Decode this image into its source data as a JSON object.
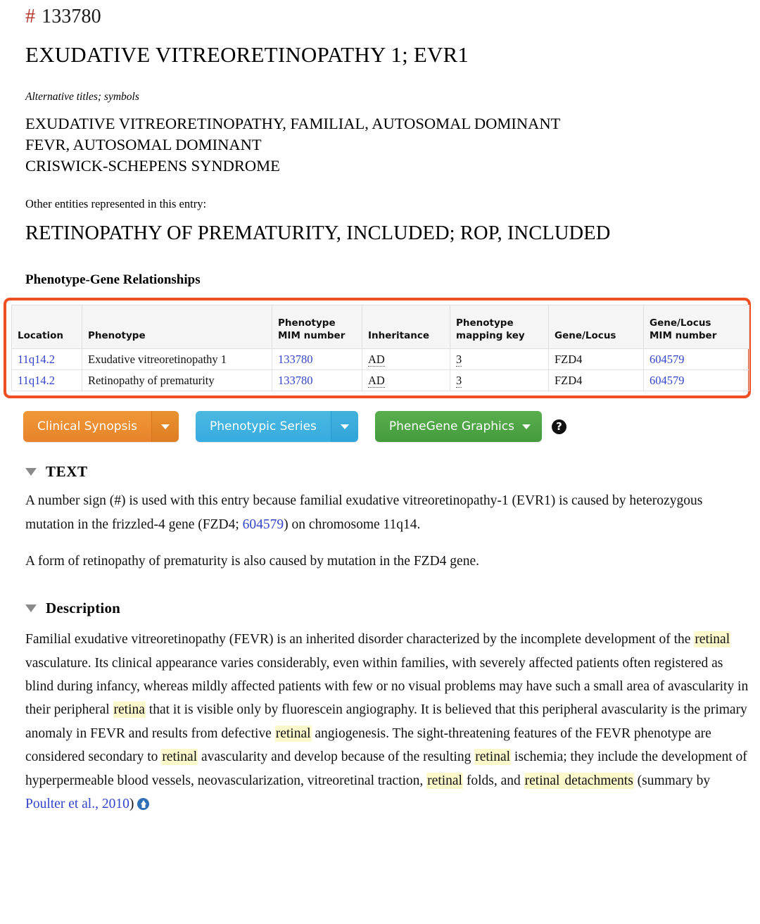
{
  "entry": {
    "hash_symbol": "#",
    "mim_number": "133780",
    "title": "EXUDATIVE VITREORETINOPATHY 1; EVR1",
    "alt_titles_label": "Alternative titles; symbols",
    "alt_titles": [
      "EXUDATIVE VITREORETINOPATHY, FAMILIAL, AUTOSOMAL DOMINANT",
      "FEVR, AUTOSOMAL DOMINANT",
      "CRISWICK-SCHEPENS SYNDROME"
    ],
    "other_entities_label": "Other entities represented in this entry:",
    "included_title": "RETINOPATHY OF PREMATURITY, INCLUDED; ROP, INCLUDED"
  },
  "pgr": {
    "heading": "Phenotype-Gene Relationships",
    "highlight_color": "#f04e23",
    "columns": [
      "Location",
      "Phenotype",
      "Phenotype MIM number",
      "Inheritance",
      "Phenotype mapping key",
      "Gene/Locus",
      "Gene/Locus MIM number"
    ],
    "columns_split": [
      [
        "Location",
        ""
      ],
      [
        "Phenotype",
        ""
      ],
      [
        "Phenotype",
        "MIM number"
      ],
      [
        "Inheritance",
        ""
      ],
      [
        "Phenotype",
        "mapping key"
      ],
      [
        "Gene/Locus",
        ""
      ],
      [
        "Gene/Locus",
        "MIM number"
      ]
    ],
    "rows": [
      {
        "location": "11q14.2",
        "phenotype": "Exudative vitreoretinopathy 1",
        "phenotype_mim": "133780",
        "inheritance": "AD",
        "mapping_key": "3",
        "gene_locus": "FZD4",
        "gene_mim": "604579"
      },
      {
        "location": "11q14.2",
        "phenotype": "Retinopathy of prematurity",
        "phenotype_mim": "133780",
        "inheritance": "AD",
        "mapping_key": "3",
        "gene_locus": "FZD4",
        "gene_mim": "604579"
      }
    ]
  },
  "buttons": {
    "clinical_synopsis": {
      "label": "Clinical Synopsis",
      "color": "#e8832a"
    },
    "phenotypic_series": {
      "label": "Phenotypic Series",
      "color": "#36ace0"
    },
    "phenegene_graphics": {
      "label": "PheneGene Graphics",
      "color": "#449b3c"
    },
    "help_glyph": "?"
  },
  "text_section": {
    "title": "TEXT",
    "paragraph1_part1": "A number sign (#) is used with this entry because familial exudative vitreoretinopathy-1 (EVR1) is caused by heterozygous mutation in the frizzled-4 gene (FZD4; ",
    "paragraph1_link": "604579",
    "paragraph1_part2": ") on chromosome 11q14.",
    "paragraph2": "A form of retinopathy of prematurity is also caused by mutation in the FZD4 gene."
  },
  "description_section": {
    "title": "Description",
    "highlight_color": "#fbf8cc",
    "segments": [
      {
        "text": "Familial exudative vitreoretinopathy (FEVR) is an inherited disorder characterized by the incomplete development of the ",
        "style": "plain"
      },
      {
        "text": "retinal",
        "style": "highlight"
      },
      {
        "text": " vasculature. Its clinical appearance varies considerably, even within families, with severely affected patients often registered as blind during infancy, whereas mildly affected patients with few or no visual problems may have such a small area of avascularity in their peripheral ",
        "style": "plain"
      },
      {
        "text": "retina",
        "style": "highlight"
      },
      {
        "text": " that it is visible only by fluorescein angiography. It is believed that this peripheral avascularity is the primary anomaly in FEVR and results from defective ",
        "style": "plain"
      },
      {
        "text": "retinal",
        "style": "highlight"
      },
      {
        "text": " angiogenesis. The sight-threatening features of the FEVR phenotype are considered secondary to ",
        "style": "plain"
      },
      {
        "text": "retinal",
        "style": "highlight"
      },
      {
        "text": " avascularity and develop because of the resulting ",
        "style": "plain"
      },
      {
        "text": "retinal",
        "style": "highlight"
      },
      {
        "text": " ischemia; they include the development of hyperpermeable blood vessels, neovascularization, vitreoretinal traction, ",
        "style": "plain"
      },
      {
        "text": "retinal",
        "style": "highlight"
      },
      {
        "text": " folds, and ",
        "style": "plain"
      },
      {
        "text": "retinal",
        "style": "highlight"
      },
      {
        "text": " detachments",
        "style": "highlight"
      },
      {
        "text": " (summary by ",
        "style": "plain"
      },
      {
        "text": "Poulter et al., 2010",
        "style": "link"
      },
      {
        "text": ")",
        "style": "plain"
      }
    ]
  }
}
